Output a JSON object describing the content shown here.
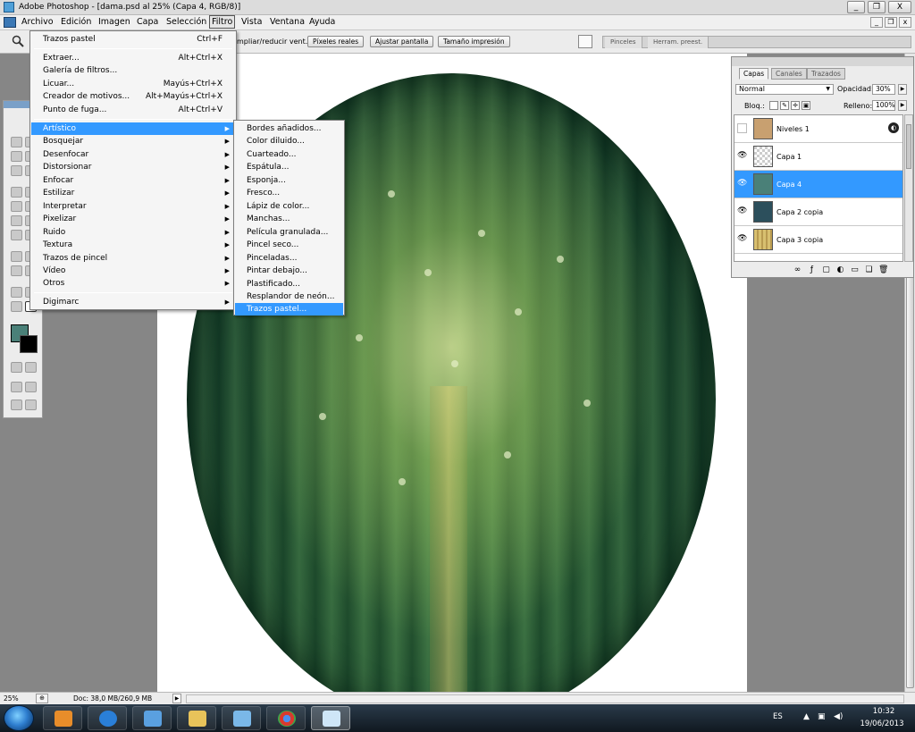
{
  "window": {
    "title": "Adobe Photoshop - [dama.psd al 25% (Capa 4, RGB/8)]",
    "buttons": [
      "_",
      "❐",
      "X"
    ],
    "mdi_buttons": [
      "_",
      "❐",
      "x"
    ]
  },
  "menubar": {
    "items": [
      "Archivo",
      "Edición",
      "Imagen",
      "Capa",
      "Selección",
      "Filtro",
      "Vista",
      "Ventana",
      "Ayuda"
    ],
    "active": "Filtro"
  },
  "options_bar": {
    "partial_label": "mpliar/reducir vent.",
    "buttons": [
      "Píxeles reales",
      "Ajustar pantalla",
      "Tamaño impresión"
    ],
    "palette_well_tabs": [
      "Pinceles",
      "Herram. preest."
    ]
  },
  "filter_menu": {
    "items": [
      {
        "label": "Trazos pastel",
        "shortcut": "Ctrl+F"
      },
      {
        "label": "Extraer...",
        "shortcut": "Alt+Ctrl+X"
      },
      {
        "label": "Galería de filtros...",
        "shortcut": ""
      },
      {
        "label": "Licuar...",
        "shortcut": "Mayús+Ctrl+X"
      },
      {
        "label": "Creador de motivos...",
        "shortcut": "Alt+Mayús+Ctrl+X"
      },
      {
        "label": "Punto de fuga...",
        "shortcut": "Alt+Ctrl+V"
      },
      {
        "label": "Artístico",
        "submenu": true
      },
      {
        "label": "Bosquejar",
        "submenu": true
      },
      {
        "label": "Desenfocar",
        "submenu": true
      },
      {
        "label": "Distorsionar",
        "submenu": true
      },
      {
        "label": "Enfocar",
        "submenu": true
      },
      {
        "label": "Estilizar",
        "submenu": true
      },
      {
        "label": "Interpretar",
        "submenu": true
      },
      {
        "label": "Pixelizar",
        "submenu": true
      },
      {
        "label": "Ruido",
        "submenu": true
      },
      {
        "label": "Textura",
        "submenu": true
      },
      {
        "label": "Trazos de pincel",
        "submenu": true
      },
      {
        "label": "Vídeo",
        "submenu": true
      },
      {
        "label": "Otros",
        "submenu": true
      },
      {
        "label": "Digimarc",
        "submenu": true
      }
    ],
    "highlighted": "Artístico"
  },
  "artistic_submenu": {
    "items": [
      "Bordes añadidos...",
      "Color diluido...",
      "Cuarteado...",
      "Espátula...",
      "Esponja...",
      "Fresco...",
      "Lápiz de color...",
      "Manchas...",
      "Película granulada...",
      "Pincel seco...",
      "Pinceladas...",
      "Pintar debajo...",
      "Plastificado...",
      "Resplandor de neón...",
      "Trazos pastel..."
    ],
    "highlighted": "Trazos pastel..."
  },
  "layers_panel": {
    "tabs": [
      "Capas",
      "Canales",
      "Trazados"
    ],
    "active_tab": "Capas",
    "blend_mode": "Normal",
    "opacity_label": "Opacidad:",
    "opacity_value": "30%",
    "lock_label": "Bloq.:",
    "fill_label": "Relleno:",
    "fill_value": "100%",
    "layers": [
      {
        "name": "Niveles 1",
        "visible": false,
        "thumb_color": "#c8a070",
        "selected": false,
        "adjustment": true
      },
      {
        "name": "Capa 1",
        "visible": true,
        "thumb_color": "#e8e8e8",
        "selected": false
      },
      {
        "name": "Capa 4",
        "visible": true,
        "thumb_color": "#4a8078",
        "selected": true
      },
      {
        "name": "Capa 2 copia",
        "visible": true,
        "thumb_color": "#2c4f5c",
        "selected": false
      },
      {
        "name": "Capa 3 copia",
        "visible": true,
        "thumb_color": "#d8c070",
        "selected": false
      }
    ]
  },
  "colors": {
    "foreground": "#4a8078",
    "background": "#000000",
    "highlight": "#3399ff"
  },
  "status_bar": {
    "zoom": "25%",
    "doc_info": "Doc: 38,0 MB/260,9 MB"
  },
  "taskbar": {
    "apps": [
      "media-player",
      "internet-explorer",
      "photo-viewer",
      "file-explorer",
      "network-app",
      "chrome",
      "photoshop"
    ],
    "language": "ES",
    "time": "10:32",
    "date": "19/06/2013"
  }
}
